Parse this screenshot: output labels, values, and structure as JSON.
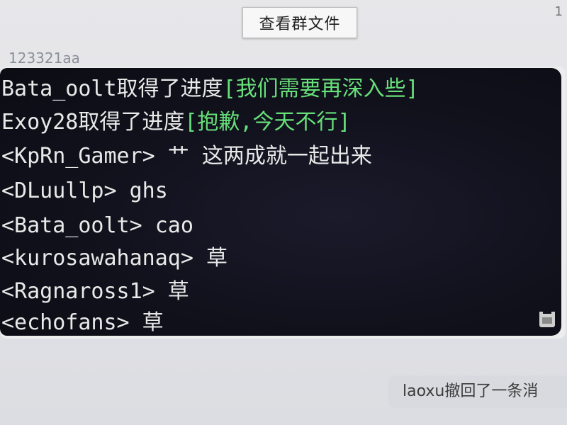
{
  "tooltip": {
    "label": "查看群文件"
  },
  "top_right": {
    "text": "1"
  },
  "message": {
    "sender": "123321aa",
    "lines": [
      {
        "part1": "Bata_oolt取得了进度",
        "part2": "[我们需要再深入些]"
      },
      {
        "part1": "Exoy28取得了进度",
        "part2": "[抱歉,今天不行]"
      },
      {
        "text": "<KpRn_Gamer> 艹 这两成就一起出来"
      },
      {
        "text": "<DLuullp> ghs"
      },
      {
        "text": "<Bata_oolt> cao"
      },
      {
        "text": "<kurosawahanaq> 草"
      },
      {
        "text": "<Ragnaross1> 草"
      },
      {
        "text": "<echofans> 草"
      }
    ]
  },
  "corner_icon": "chat-helmet-icon",
  "system_note": {
    "text": "laoxu撤回了一条消"
  },
  "colors": {
    "progress": "#67e07a",
    "text": "#e9e9e9",
    "screen": "#11111c"
  }
}
